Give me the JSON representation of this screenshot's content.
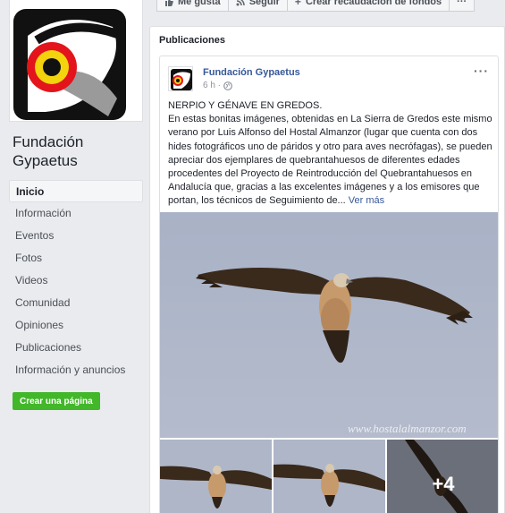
{
  "page": {
    "name": "Fundación Gypaetus"
  },
  "actions": {
    "like_label": "Me gusta",
    "follow_label": "Seguir",
    "fundraiser_label": "Crear recaudación de fondos",
    "more_label": "···"
  },
  "nav": {
    "items": [
      {
        "label": "Inicio",
        "active": true
      },
      {
        "label": "Información"
      },
      {
        "label": "Eventos"
      },
      {
        "label": "Fotos"
      },
      {
        "label": "Videos"
      },
      {
        "label": "Comunidad"
      },
      {
        "label": "Opiniones"
      },
      {
        "label": "Publicaciones"
      },
      {
        "label": "Información y anuncios"
      }
    ],
    "create_page_label": "Crear una página"
  },
  "feed": {
    "section_title": "Publicaciones",
    "post": {
      "author": "Fundación Gypaetus",
      "time": "6 h ·",
      "menu": "···",
      "heading": "NERPIO Y GÉNAVE EN GREDOS.",
      "body": "En estas bonitas imágenes, obtenidas en La Sierra de Gredos este mismo verano por Luis Alfonso del Hostal Almanzor (lugar que cuenta con dos hides fotográficos uno de páridos y otro para aves necrófagas), se pueden apreciar dos ejemplares de quebrantahuesos de diferentes edades procedentes del Proyecto de Reintroducción del Quebrantahuesos en Andalucía que, gracias a las excelentes imágenes y a los emisores que portan, los técnicos de Seguimiento de...",
      "see_more": "Ver más",
      "watermark": "www.hostalalmanzor.com",
      "more_photos": "+4"
    }
  },
  "colors": {
    "link": "#365899",
    "green_button": "#42b72a",
    "sky": "#aeb6c8"
  }
}
